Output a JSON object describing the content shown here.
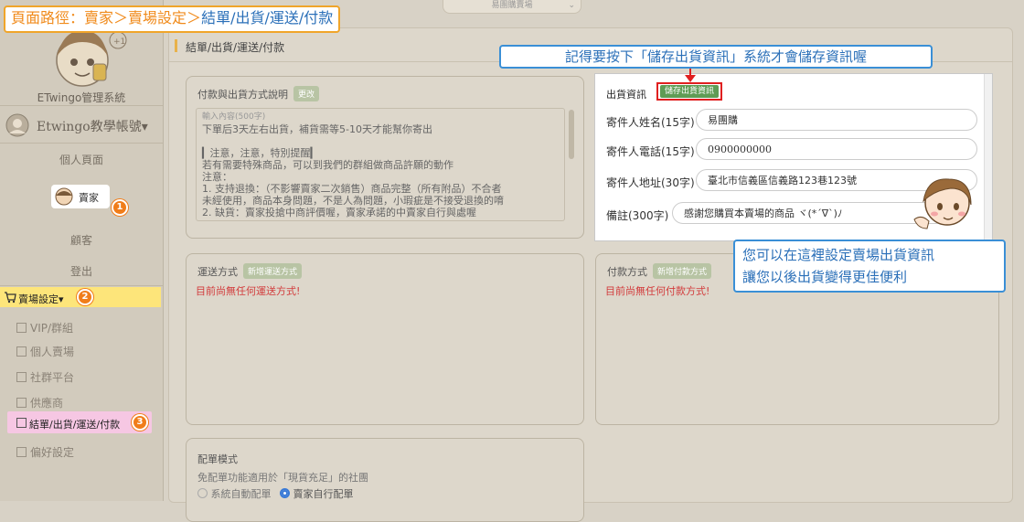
{
  "breadcrumb": {
    "text": "頁面路徑：賣家＞賣場設定＞結單/出貨/運送/付款",
    "prefix": "頁面路徑：賣家",
    "sep1": "＞",
    "mid": "賣場設定",
    "sep2": "＞",
    "current": "結單/出貨/運送/付款"
  },
  "topbar": {
    "dropdown_value": "易團購賣場"
  },
  "sidebar": {
    "system_name": "ETwingo管理系統",
    "account_name": "Etwingo教學帳號▾",
    "profile": "個人頁面",
    "seller": "賣家",
    "customer": "顧客",
    "logout": "登出",
    "store_settings": "賣場設定▾",
    "sub_items": [
      "VIP/群組",
      "個人賣場",
      "社群平台",
      "供應商",
      "結單/出貨/運送/付款",
      "偏好設定"
    ],
    "badges": [
      "1",
      "2",
      "3"
    ]
  },
  "main": {
    "page_title": "結單/出貨/運送/付款",
    "payment_shipping_desc": {
      "title": "付款與出貨方式說明",
      "edit_button": "更改",
      "hint": "輸入內容(500字)",
      "lines": [
        "下單后3天左右出貨，補貨需等5-10天才能幫你寄出",
        "",
        "▎注意，注意，特別提醒▎",
        "若有需要特殊商品，可以到我們的群組做商品許願的動作",
        "注意：",
        "1. 支持退換：（不影響賣家二次銷售）商品完整（所有附品）不合者",
        "    未經使用，商品本身問題，不是人為問題，小瑕疵是不接受退換的唷",
        "2. 缺貨：賣家投搶中商評價喔，賣家承諾的中賣家自行與處喔"
      ]
    },
    "shipping_method": {
      "title": "運送方式",
      "add_button": "新增運送方式",
      "empty": "目前尚無任何運送方式!"
    },
    "payment_method": {
      "title": "付款方式",
      "add_button": "新增付款方式",
      "empty": "目前尚無任何付款方式!"
    },
    "order_mode": {
      "title": "配單模式",
      "desc": "免配單功能適用於「現貨充足」的社團",
      "option_auto": "系統自動配單",
      "option_manual": "賣家自行配單"
    },
    "shipping_info": {
      "title": "出貨資訊",
      "save_button": "儲存出貨資訊",
      "fields": [
        {
          "label": "寄件人姓名(15字)",
          "value": "易團購"
        },
        {
          "label": "寄件人電話(15字)",
          "value": "0900000000"
        },
        {
          "label": "寄件人地址(30字)",
          "value": "臺北市信義區信義路123巷123號"
        },
        {
          "label": "備註(300字)",
          "value": "感謝您購買本賣場的商品 ヾ(*´∇`)ﾉ"
        }
      ]
    }
  },
  "callouts": {
    "top": "記得要按下「儲存出貨資訊」系統才會儲存資訊喔",
    "right_line1": "您可以在這裡設定賣場出貨資訊",
    "right_line2": "讓您以後出貨變得更佳便利"
  },
  "colors": {
    "accent_blue": "#2a6fb8",
    "highlight_yellow": "#fde57a",
    "highlight_pink": "#f6c7e3",
    "badge_orange": "#f07d1a",
    "alert_red": "#e02020"
  }
}
